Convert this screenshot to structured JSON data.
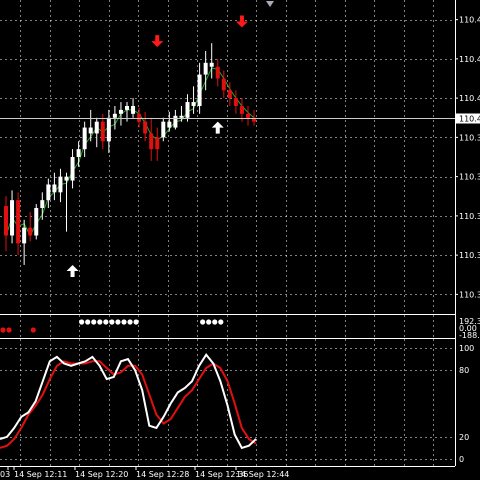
{
  "chart_data": [
    {
      "type": "candlestick",
      "panel": "price",
      "ylim": [
        110.3,
        110.5
      ],
      "y_tick_labels": [
        "110.4",
        "110.4",
        "110.4",
        "110.3",
        "110.3",
        "110.3",
        "110.3",
        "110.3"
      ],
      "y_tick_values": [
        110.48,
        110.46,
        110.44,
        110.42,
        110.4,
        110.38,
        110.36,
        110.34
      ],
      "current_price_label": "110.4",
      "current_price": 110.43,
      "grid": true,
      "candles": [
        {
          "o": 110.385,
          "h": 110.39,
          "l": 110.362,
          "c": 110.37,
          "color": "red"
        },
        {
          "o": 110.37,
          "h": 110.393,
          "l": 110.366,
          "c": 110.388,
          "color": "white"
        },
        {
          "o": 110.388,
          "h": 110.392,
          "l": 110.36,
          "c": 110.366,
          "color": "red"
        },
        {
          "o": 110.366,
          "h": 110.378,
          "l": 110.355,
          "c": 110.374,
          "color": "white"
        },
        {
          "o": 110.374,
          "h": 110.382,
          "l": 110.367,
          "c": 110.37,
          "color": "red"
        },
        {
          "o": 110.37,
          "h": 110.386,
          "l": 110.368,
          "c": 110.384,
          "color": "white"
        },
        {
          "o": 110.384,
          "h": 110.392,
          "l": 110.378,
          "c": 110.388,
          "color": "white"
        },
        {
          "o": 110.388,
          "h": 110.399,
          "l": 110.384,
          "c": 110.396,
          "color": "white"
        },
        {
          "o": 110.396,
          "h": 110.402,
          "l": 110.388,
          "c": 110.392,
          "color": "white"
        },
        {
          "o": 110.392,
          "h": 110.404,
          "l": 110.387,
          "c": 110.4,
          "color": "white"
        },
        {
          "o": 110.4,
          "h": 110.402,
          "l": 110.372,
          "c": 110.398,
          "color": "white"
        },
        {
          "o": 110.398,
          "h": 110.414,
          "l": 110.394,
          "c": 110.41,
          "color": "white"
        },
        {
          "o": 110.41,
          "h": 110.418,
          "l": 110.405,
          "c": 110.414,
          "color": "white"
        },
        {
          "o": 110.414,
          "h": 110.428,
          "l": 110.41,
          "c": 110.425,
          "color": "white"
        },
        {
          "o": 110.425,
          "h": 110.434,
          "l": 110.418,
          "c": 110.422,
          "color": "white"
        },
        {
          "o": 110.422,
          "h": 110.43,
          "l": 110.415,
          "c": 110.428,
          "color": "white"
        },
        {
          "o": 110.428,
          "h": 110.432,
          "l": 110.414,
          "c": 110.418,
          "color": "red"
        },
        {
          "o": 110.418,
          "h": 110.434,
          "l": 110.412,
          "c": 110.43,
          "color": "white"
        },
        {
          "o": 110.43,
          "h": 110.436,
          "l": 110.424,
          "c": 110.432,
          "color": "white"
        },
        {
          "o": 110.432,
          "h": 110.438,
          "l": 110.426,
          "c": 110.434,
          "color": "white"
        },
        {
          "o": 110.434,
          "h": 110.438,
          "l": 110.428,
          "c": 110.436,
          "color": "white"
        },
        {
          "o": 110.436,
          "h": 110.44,
          "l": 110.43,
          "c": 110.432,
          "color": "white"
        },
        {
          "o": 110.432,
          "h": 110.435,
          "l": 110.425,
          "c": 110.428,
          "color": "red"
        },
        {
          "o": 110.428,
          "h": 110.433,
          "l": 110.418,
          "c": 110.422,
          "color": "red"
        },
        {
          "o": 110.422,
          "h": 110.43,
          "l": 110.408,
          "c": 110.414,
          "color": "red"
        },
        {
          "o": 110.414,
          "h": 110.425,
          "l": 110.408,
          "c": 110.42,
          "color": "red"
        },
        {
          "o": 110.42,
          "h": 110.43,
          "l": 110.418,
          "c": 110.428,
          "color": "white"
        },
        {
          "o": 110.428,
          "h": 110.433,
          "l": 110.423,
          "c": 110.425,
          "color": "white"
        },
        {
          "o": 110.425,
          "h": 110.434,
          "l": 110.424,
          "c": 110.431,
          "color": "white"
        },
        {
          "o": 110.431,
          "h": 110.436,
          "l": 110.428,
          "c": 110.43,
          "color": "white"
        },
        {
          "o": 110.43,
          "h": 110.442,
          "l": 110.428,
          "c": 110.438,
          "color": "white"
        },
        {
          "o": 110.438,
          "h": 110.446,
          "l": 110.432,
          "c": 110.436,
          "color": "white"
        },
        {
          "o": 110.436,
          "h": 110.458,
          "l": 110.432,
          "c": 110.452,
          "color": "white"
        },
        {
          "o": 110.452,
          "h": 110.464,
          "l": 110.444,
          "c": 110.458,
          "color": "white"
        },
        {
          "o": 110.458,
          "h": 110.468,
          "l": 110.45,
          "c": 110.456,
          "color": "white"
        },
        {
          "o": 110.456,
          "h": 110.46,
          "l": 110.446,
          "c": 110.45,
          "color": "red"
        },
        {
          "o": 110.45,
          "h": 110.454,
          "l": 110.44,
          "c": 110.444,
          "color": "red"
        },
        {
          "o": 110.444,
          "h": 110.448,
          "l": 110.436,
          "c": 110.44,
          "color": "red"
        },
        {
          "o": 110.44,
          "h": 110.444,
          "l": 110.432,
          "c": 110.436,
          "color": "red"
        },
        {
          "o": 110.436,
          "h": 110.44,
          "l": 110.428,
          "c": 110.432,
          "color": "red"
        },
        {
          "o": 110.432,
          "h": 110.436,
          "l": 110.426,
          "c": 110.43,
          "color": "red"
        },
        {
          "o": 110.43,
          "h": 110.434,
          "l": 110.426,
          "c": 110.428,
          "color": "red"
        }
      ],
      "arrows": [
        {
          "index": 11,
          "dir": "up",
          "color": "#ffffff",
          "price": 110.355
        },
        {
          "index": 35,
          "dir": "up",
          "color": "#ffffff",
          "price": 110.428
        },
        {
          "index": 25,
          "dir": "down",
          "color": "#ff1a1a",
          "price": 110.466
        },
        {
          "index": 39,
          "dir": "down",
          "color": "#ff1a1a",
          "price": 110.476
        }
      ],
      "ma_color": "#22aa22"
    },
    {
      "type": "dots",
      "panel": "signal",
      "axis_labels": [
        "192.3",
        "0.00",
        "-188.5"
      ],
      "red_dots": [
        0,
        1,
        5
      ],
      "white_dots": [
        13,
        14,
        15,
        16,
        17,
        18,
        19,
        20,
        21,
        22,
        33,
        34,
        35,
        36
      ]
    },
    {
      "type": "line",
      "panel": "stochastic",
      "ylim": [
        0,
        100
      ],
      "y_tick_labels": [
        "100",
        "80",
        "20",
        "0"
      ],
      "y_tick_values": [
        100,
        80,
        20,
        0
      ],
      "series": [
        {
          "color": "#ffffff",
          "values": [
            18,
            20,
            28,
            38,
            42,
            52,
            70,
            88,
            92,
            86,
            84,
            86,
            88,
            92,
            84,
            72,
            74,
            88,
            90,
            80,
            62,
            30,
            28,
            38,
            50,
            60,
            64,
            70,
            84,
            94,
            86,
            70,
            48,
            22,
            10,
            12,
            18
          ]
        },
        {
          "color": "#e01010",
          "values": [
            10,
            12,
            18,
            28,
            40,
            48,
            58,
            72,
            84,
            88,
            86,
            86,
            86,
            88,
            88,
            82,
            76,
            78,
            84,
            84,
            76,
            58,
            40,
            32,
            36,
            46,
            56,
            62,
            72,
            82,
            86,
            82,
            70,
            50,
            28,
            18,
            14
          ]
        }
      ]
    }
  ],
  "time_labels": [
    "03",
    "14 Sep 12:11",
    "14 Sep 12:20",
    "14 Sep 12:28",
    "14 Sep 12:36",
    "14 Sep 12:44"
  ],
  "colors": {
    "background": "#000000",
    "grid": "#ffffff",
    "bull": "#ffffff",
    "bear": "#e01010",
    "text": "#ffffff"
  }
}
